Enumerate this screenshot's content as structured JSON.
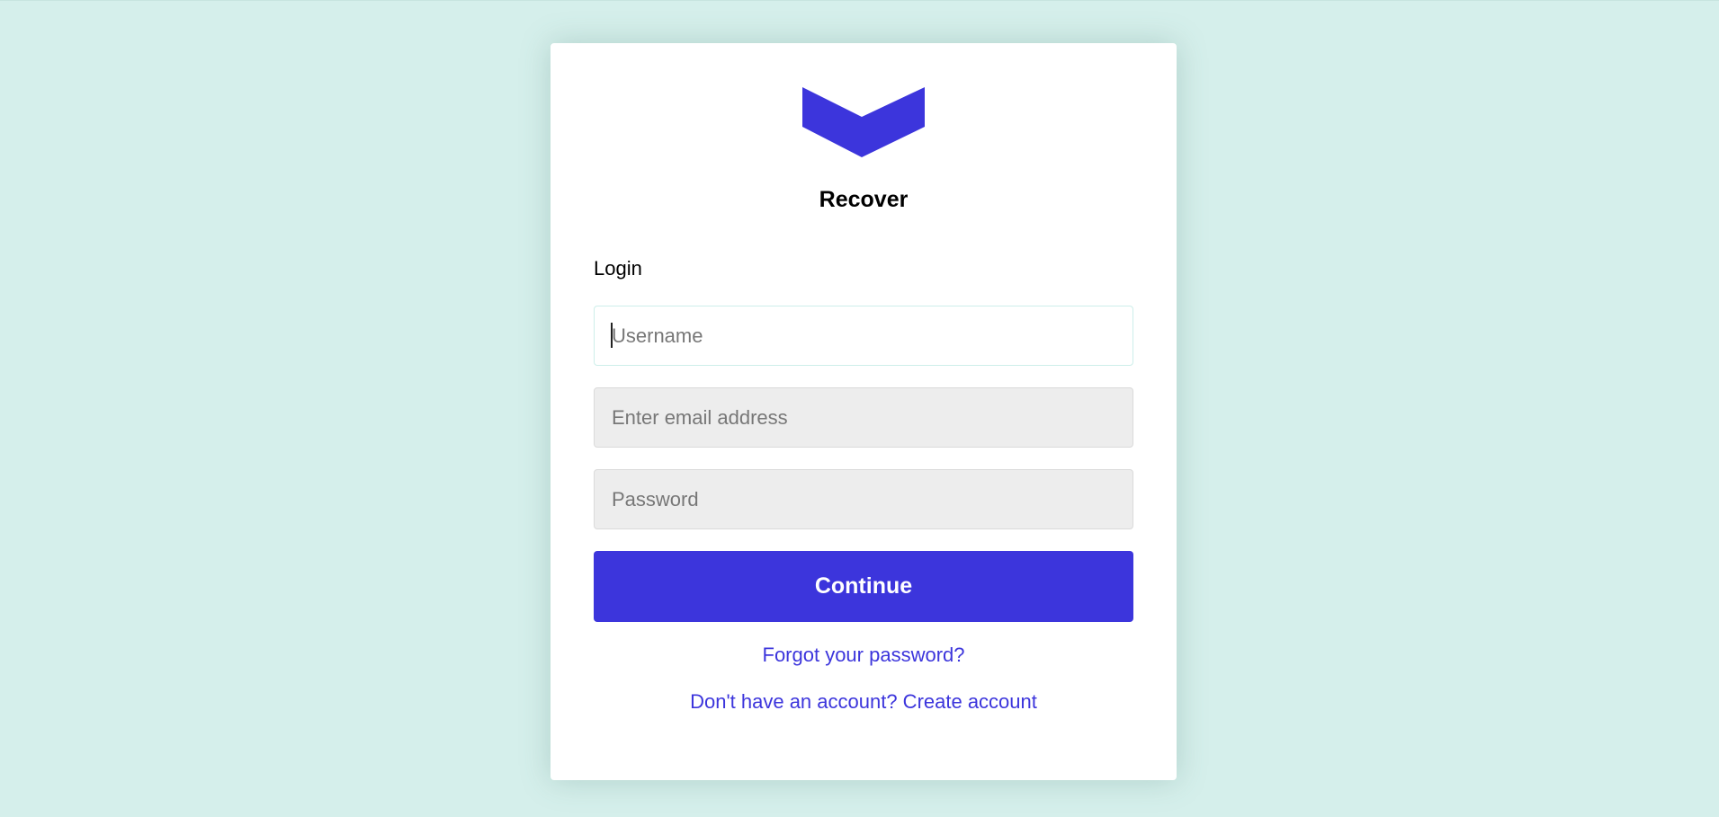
{
  "colors": {
    "background": "#d5efeb",
    "card": "#ffffff",
    "accent": "#3c35dc",
    "input_disabled": "#ededed"
  },
  "logo": {
    "icon": "chevron-down-icon",
    "color": "#3c35dc"
  },
  "brand": {
    "title": "Recover"
  },
  "form": {
    "label": "Login",
    "username": {
      "placeholder": "Username",
      "value": ""
    },
    "email": {
      "placeholder": "Enter email address",
      "value": ""
    },
    "password": {
      "placeholder": "Password",
      "value": ""
    },
    "submit_label": "Continue"
  },
  "links": {
    "forgot_password": "Forgot your password?",
    "create_account": "Don't have an account? Create account"
  }
}
